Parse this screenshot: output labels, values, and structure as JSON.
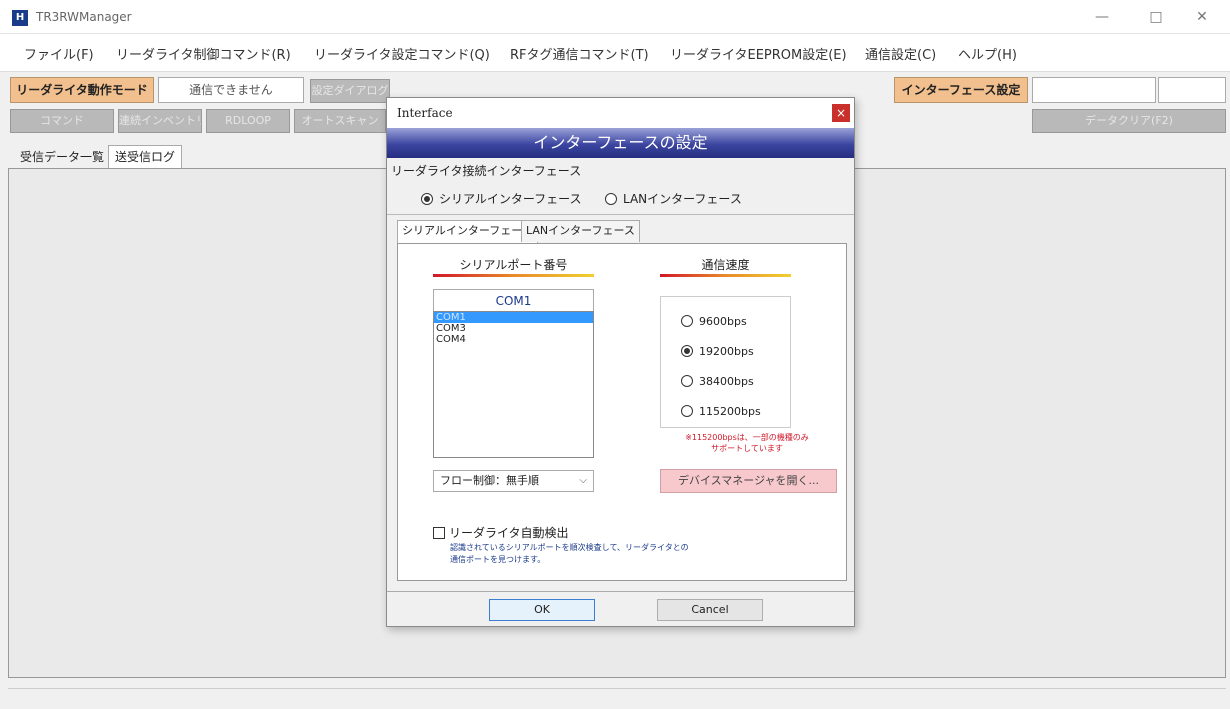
{
  "window": {
    "app_icon_glyph": "H",
    "title": "TR3RWManager",
    "minimize": "—",
    "maximize": "□",
    "close": "✕"
  },
  "menu": {
    "items": [
      "ファイル(F)",
      "リーダライタ制御コマンド(R)",
      "リーダライタ設定コマンド(Q)",
      "RFタグ通信コマンド(T)",
      "リーダライタEEPROM設定(E)",
      "通信設定(C)",
      "ヘルプ(H)"
    ]
  },
  "toolbar": {
    "mode_button": "リーダライタ動作モード",
    "status": "通信できません",
    "settings_dialog_button": "設定ダイアログ",
    "interface_settings_button": "インターフェース設定",
    "command_button": "コマンド",
    "inventory_button": "連続インベントリ",
    "rdloop_button": "RDLOOP",
    "autoscan_button": "オートスキャン",
    "clear_button": "データクリア(F2)"
  },
  "main_tabs": [
    "受信データ一覧",
    "送受信ログ"
  ],
  "dialog": {
    "title": "Interface",
    "close": "×",
    "header": "インターフェースの設定",
    "group_label": "リーダライタ接続インターフェース",
    "radio_serial": "シリアルインターフェース",
    "radio_lan": "LANインターフェース",
    "selected_interface": "serial",
    "tabs": [
      "シリアルインターフェース",
      "LANインターフェース"
    ],
    "port_title": "シリアルポート番号",
    "speed_title": "通信速度",
    "current_port": "COM1",
    "ports": [
      "COM1",
      "COM3",
      "COM4"
    ],
    "selected_port": "COM1",
    "flow_control": "フロー制御：無手順",
    "flow_chevron": "⌵",
    "speeds": [
      "9600bps",
      "19200bps",
      "38400bps",
      "115200bps"
    ],
    "selected_speed": "19200bps",
    "note_line1": "※115200bpsは、一部の機種のみ",
    "note_line2": "サポートしています",
    "device_manager_button": "デバイスマネージャを開く...",
    "auto_detect_label": "リーダライタ自動検出",
    "auto_detect_checked": false,
    "auto_detect_desc_line1": "認識されているシリアルポートを順次検査して、リーダライタとの",
    "auto_detect_desc_line2": "通信ポートを見つけます。",
    "ok_button": "OK",
    "cancel_button": "Cancel"
  },
  "colors": {
    "accent_orange": "#f2c08e",
    "dialog_header": "#252d80",
    "selection": "#3399ff",
    "note_red": "#d0182a",
    "close_red": "#c9302c"
  }
}
